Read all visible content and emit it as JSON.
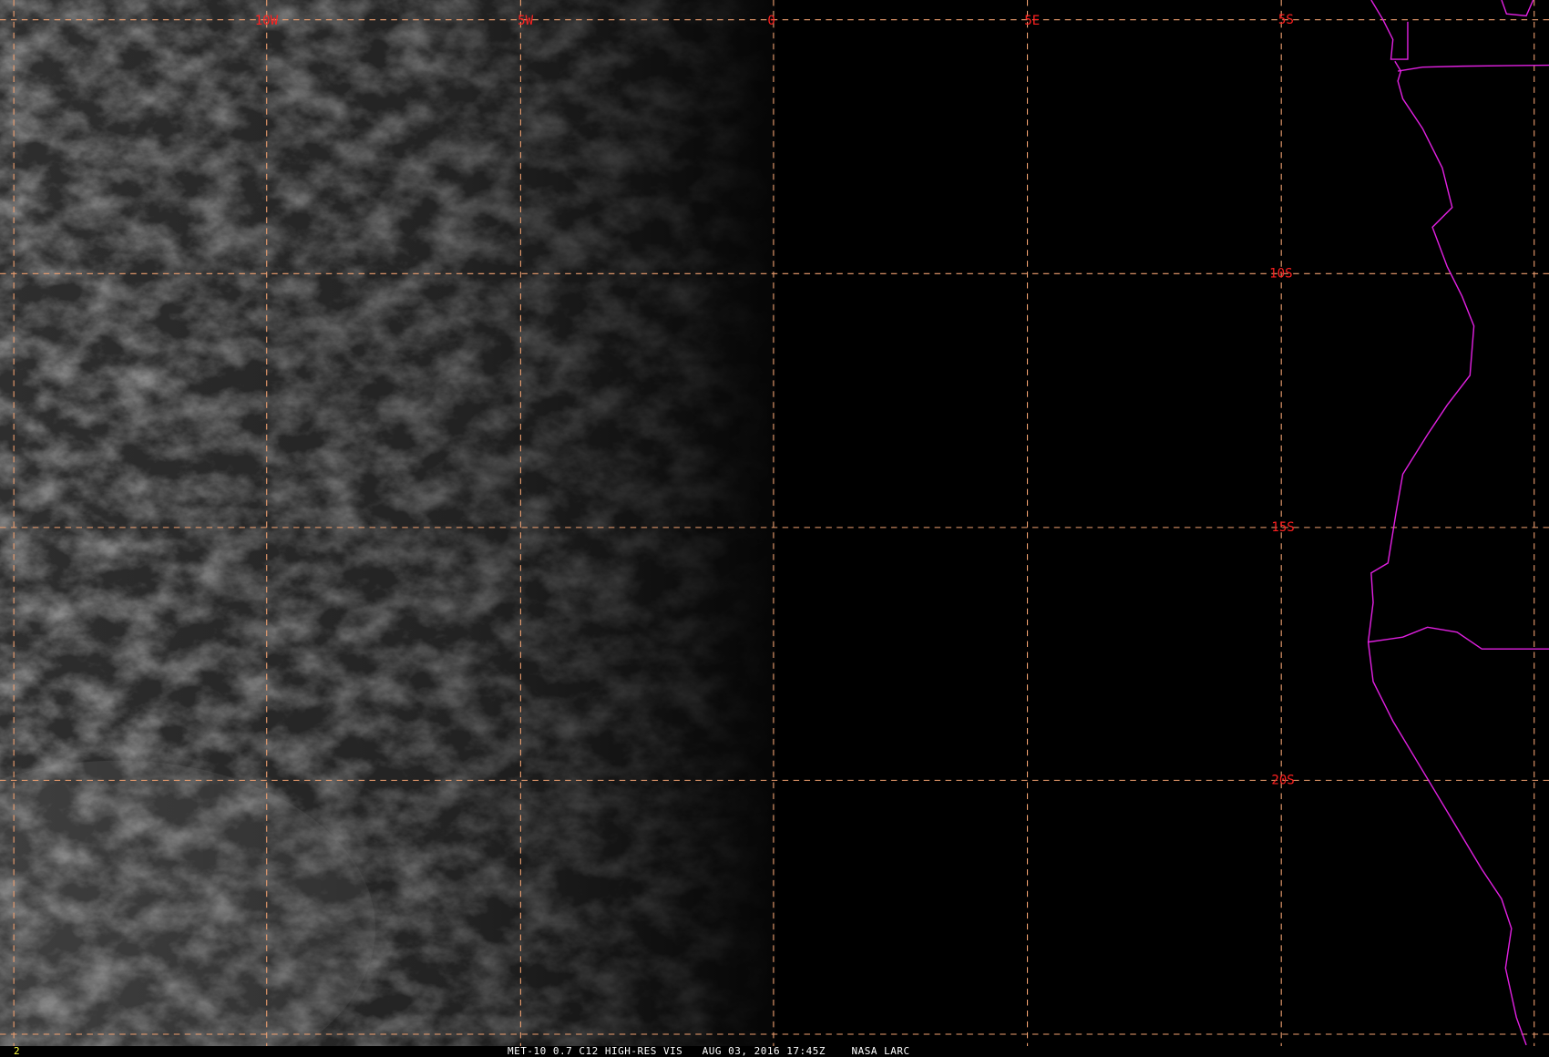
{
  "image": {
    "frame_number": "2",
    "caption": "MET-10 0.7 C12 HIGH-RES VIS   AUG 03, 2016 17:45Z    NASA LARC"
  },
  "grid": {
    "longitude_labels": [
      "10W",
      "5W",
      "0",
      "5E"
    ],
    "latitude_labels": [
      "5S",
      "10S",
      "15S",
      "20S"
    ]
  },
  "colors": {
    "grid": "#f0a070",
    "label": "#ff2020",
    "coastline": "#e020e0",
    "frame_number": "#ffff40"
  }
}
